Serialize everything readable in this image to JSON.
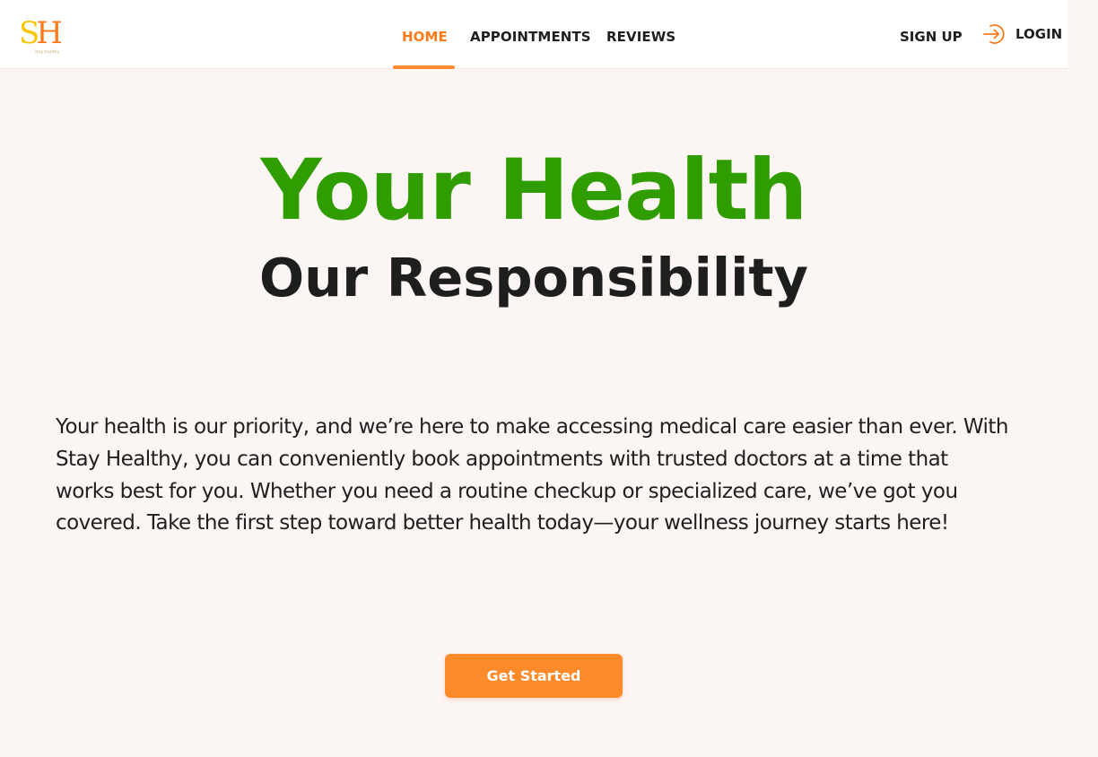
{
  "brand": {
    "logo_letters_s": "S",
    "logo_letters_h": "H",
    "logo_tagline": "stay healthy",
    "colors": {
      "logo_s": "#f7c600",
      "logo_h": "#ff7a1a"
    }
  },
  "nav": {
    "links": [
      {
        "label": "HOME",
        "active": true
      },
      {
        "label": "APPOINTMENTS",
        "active": false
      },
      {
        "label": "REVIEWS",
        "active": false
      }
    ],
    "signup_label": "SIGN UP",
    "login_label": "LOGIN",
    "login_icon": "login-arrow-icon"
  },
  "hero": {
    "title": "Your Health",
    "subtitle": "Our Responsibility",
    "paragraph": "Your health is our priority, and we’re here to make accessing medical care easier than ever. With Stay Healthy, you can conveniently book appointments with trusted doctors at a time that works best for you. Whether you need a routine checkup or specialized care, we’ve got you covered. Take the first step toward better health today—your wellness journey starts here!",
    "cta_label": "Get Started"
  },
  "colors": {
    "accent": "#ff7a1a",
    "title_green": "#2f9d00",
    "background": "#fbf5f4",
    "text": "#1f1f1f"
  }
}
